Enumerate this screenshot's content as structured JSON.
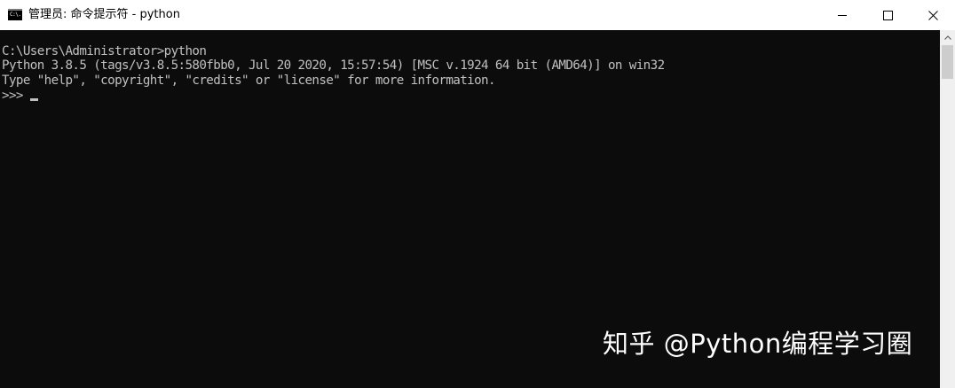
{
  "window": {
    "icon_label": "C:\\.",
    "title": "管理员: 命令提示符 - python",
    "controls": {
      "minimize": "minimize-icon",
      "maximize": "maximize-icon",
      "close": "close-icon"
    }
  },
  "console": {
    "lines": [
      "C:\\Users\\Administrator>python",
      "Python 3.8.5 (tags/v3.8.5:580fbb0, Jul 20 2020, 15:57:54) [MSC v.1924 64 bit (AMD64)] on win32",
      "Type \"help\", \"copyright\", \"credits\" or \"license\" for more information.",
      ">>>"
    ],
    "background_color": "#0c0c0c",
    "text_color": "#c0c0c0"
  },
  "watermark": {
    "text": "知乎 @Python编程学习圈"
  }
}
